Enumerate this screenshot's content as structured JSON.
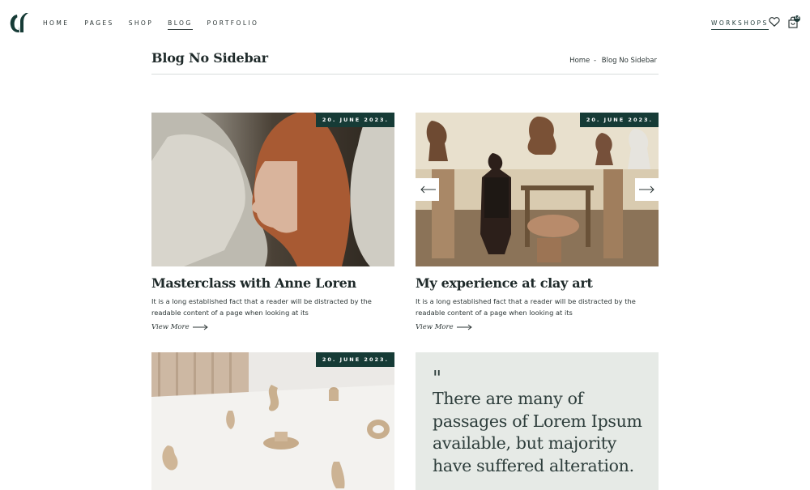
{
  "header": {
    "nav": [
      "HOME",
      "PAGES",
      "SHOP",
      "BLOG",
      "PORTFOLIO"
    ],
    "active": "BLOG",
    "workshops": "WORKSHOPS",
    "cart_count": "14",
    "icons": {
      "logo": "brand-logo",
      "wishlist": "heart-icon",
      "cart": "shopping-bag-icon"
    }
  },
  "title_bar": {
    "title": "Blog No Sidebar",
    "breadcrumb": {
      "home": "Home",
      "separator": "-",
      "current": "Blog No Sidebar"
    }
  },
  "posts": [
    {
      "date": "20. JUNE 2023.",
      "title": "Masterclass with Anne Loren",
      "excerpt": "It is a long established fact that a reader will be distracted by the readable content of a page when looking at its",
      "link": "View More"
    },
    {
      "date": "20. JUNE 2023.",
      "title": "My experience at clay art",
      "excerpt": "It is a long established fact that a reader will be distracted by the readable content of a page when looking at its",
      "link": "View More"
    },
    {
      "date": "20. JUNE 2023."
    }
  ],
  "quote": {
    "mark": "\"",
    "text": "There are many of passages of Lorem Ipsum available, but majority have suffered alteration."
  },
  "colors": {
    "accent": "#163b36",
    "quote_bg": "#e6eae6",
    "text": "#1f2a2a"
  }
}
